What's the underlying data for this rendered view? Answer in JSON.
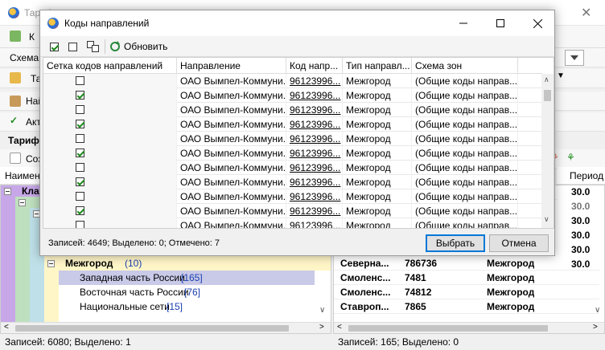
{
  "app": {
    "title": "Тарифы",
    "toolbar_label": "К",
    "schema_label": "Схема з",
    "tree_toolbar_label": "Та",
    "find_label": "Най",
    "active_label": "Акт",
    "tariff_label": "Тарифн",
    "create_label": "Соз",
    "tree_header": "Наимено",
    "right_header_period": "Период с",
    "tree": {
      "klass_label": "Клас",
      "mezhgorod_label": "Межгород",
      "mezhgorod_count": "(10)",
      "children": [
        {
          "label": "Западная часть России",
          "count": "[165]"
        },
        {
          "label": "Восточная часть России",
          "count": "[76]"
        },
        {
          "label": "Национальные сети",
          "count": "[15]"
        }
      ]
    },
    "right_rows": [
      {
        "c1": "Северна...",
        "c2": "786736",
        "c3": "Межгород"
      },
      {
        "c1": "Смоленс...",
        "c2": "7481",
        "c3": "Межгород"
      },
      {
        "c1": "Смоленс...",
        "c2": "74812",
        "c3": "Межгород"
      },
      {
        "c1": "Ставроп...",
        "c2": "7865",
        "c3": "Межгород"
      }
    ],
    "right_period_values": [
      "30.0",
      "30.0",
      "30.0",
      "30.0",
      "30.0",
      "30.0"
    ],
    "status_left": "Записей: 6080; Выделено: 1",
    "status_right": "Записей: 165; Выделено: 0"
  },
  "dialog": {
    "title": "Коды направлений",
    "refresh_label": "Обновить",
    "columns": [
      "Сетка кодов направлений",
      "Направление",
      "Код напр...",
      "Тип направл...",
      "Схема зон"
    ],
    "rows": [
      {
        "checked": false,
        "direction": "ОАО Вымпел-Коммуни...",
        "code": "96123996...",
        "type": "Межгород",
        "zone": "(Общие коды направ..."
      },
      {
        "checked": true,
        "direction": "ОАО Вымпел-Коммуни...",
        "code": "96123996...",
        "type": "Межгород",
        "zone": "(Общие коды направ..."
      },
      {
        "checked": false,
        "direction": "ОАО Вымпел-Коммуни...",
        "code": "96123996...",
        "type": "Межгород",
        "zone": "(Общие коды направ..."
      },
      {
        "checked": true,
        "direction": "ОАО Вымпел-Коммуни...",
        "code": "96123996...",
        "type": "Межгород",
        "zone": "(Общие коды направ..."
      },
      {
        "checked": false,
        "direction": "ОАО Вымпел-Коммуни...",
        "code": "96123996...",
        "type": "Межгород",
        "zone": "(Общие коды направ..."
      },
      {
        "checked": true,
        "direction": "ОАО Вымпел-Коммуни...",
        "code": "96123996...",
        "type": "Межгород",
        "zone": "(Общие коды направ..."
      },
      {
        "checked": false,
        "direction": "ОАО Вымпел-Коммуни...",
        "code": "96123996...",
        "type": "Межгород",
        "zone": "(Общие коды направ..."
      },
      {
        "checked": true,
        "direction": "ОАО Вымпел-Коммуни...",
        "code": "96123996...",
        "type": "Межгород",
        "zone": "(Общие коды направ..."
      },
      {
        "checked": false,
        "direction": "ОАО Вымпел-Коммуни...",
        "code": "96123996...",
        "type": "Межгород",
        "zone": "(Общие коды направ..."
      },
      {
        "checked": true,
        "direction": "ОАО Вымпел-Коммуни...",
        "code": "96123996...",
        "type": "Межгород",
        "zone": "(Общие коды направ..."
      },
      {
        "checked": false,
        "direction": "ОАО Вымпел-Коммуни...",
        "code": "96123996...",
        "type": "Межгород",
        "zone": "(Общие коды направ..."
      }
    ],
    "status": "Записей: 4649; Выделено: 0; Отмечено: 7",
    "select_button": "Выбрать",
    "cancel_button": "Отмена"
  }
}
